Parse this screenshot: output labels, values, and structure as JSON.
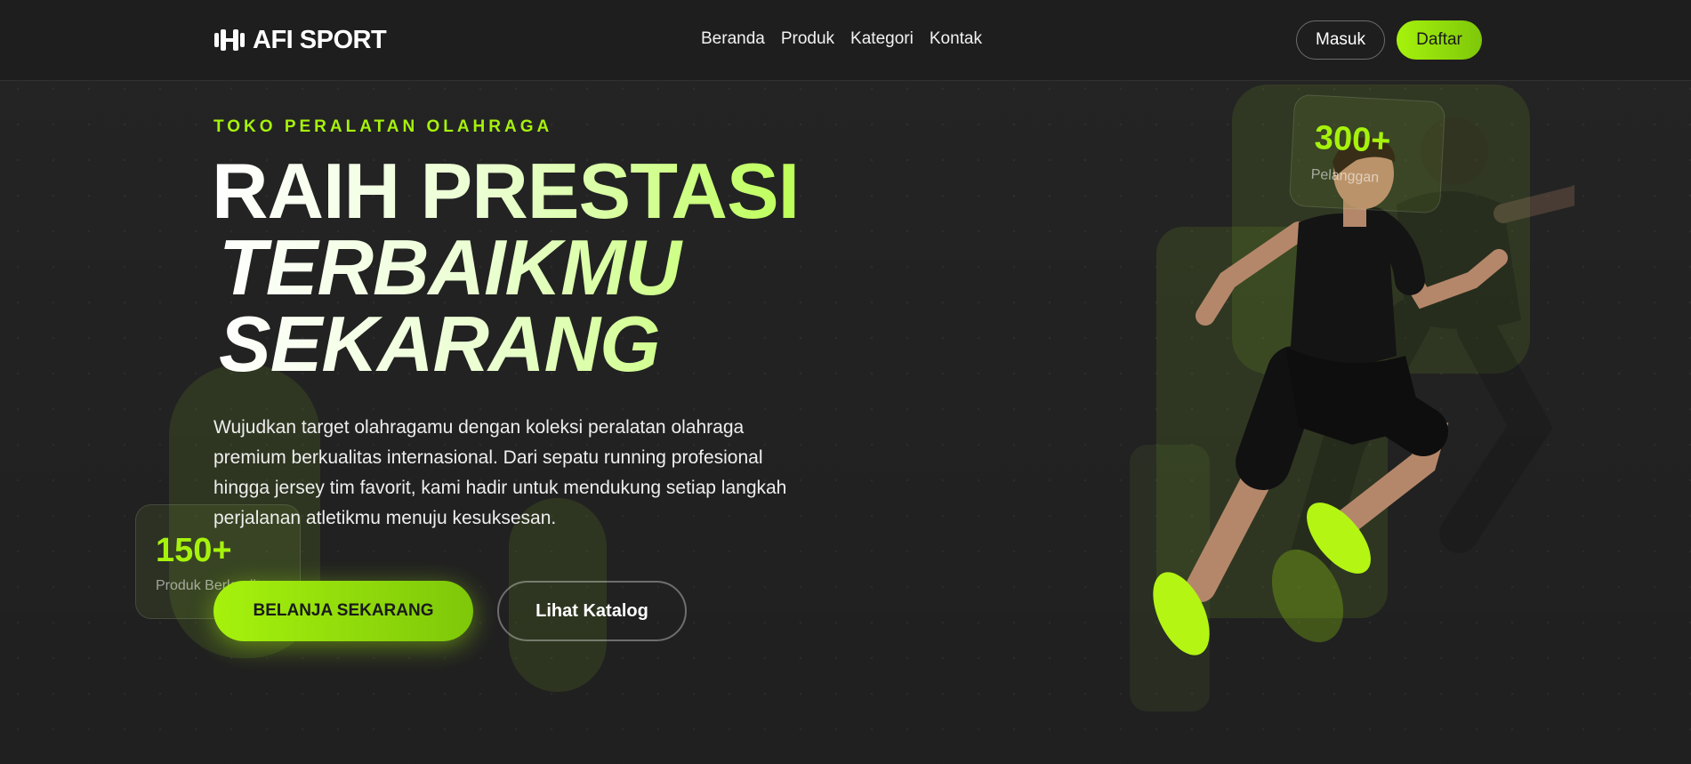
{
  "header": {
    "brand": "AFI SPORT",
    "nav": [
      "Beranda",
      "Produk",
      "Kategori",
      "Kontak"
    ],
    "login_label": "Masuk",
    "register_label": "Daftar"
  },
  "hero": {
    "eyebrow": "TOKO PERALATAN OLAHRAGA",
    "headline_1": "RAIH PRESTASI",
    "headline_2": "TERBAIKMU",
    "headline_3": "SEKARANG",
    "description": "Wujudkan target olahragamu dengan koleksi peralatan olahraga premium berkualitas internasional. Dari sepatu running profesional hingga jersey tim favorit, kami hadir untuk mendukung setiap langkah perjalanan atletikmu menuju kesuksesan.",
    "primary_cta": "BELANJA SEKARANG",
    "secondary_cta": "Lihat Katalog"
  },
  "stats": {
    "products": {
      "value": "150+",
      "label": "Produk Berkualitas"
    },
    "customers": {
      "value": "300+",
      "label": "Pelanggan"
    }
  },
  "colors": {
    "accent": "#a6f20c",
    "background": "#242424"
  },
  "icons": {
    "logo": "dumbbell-icon"
  }
}
